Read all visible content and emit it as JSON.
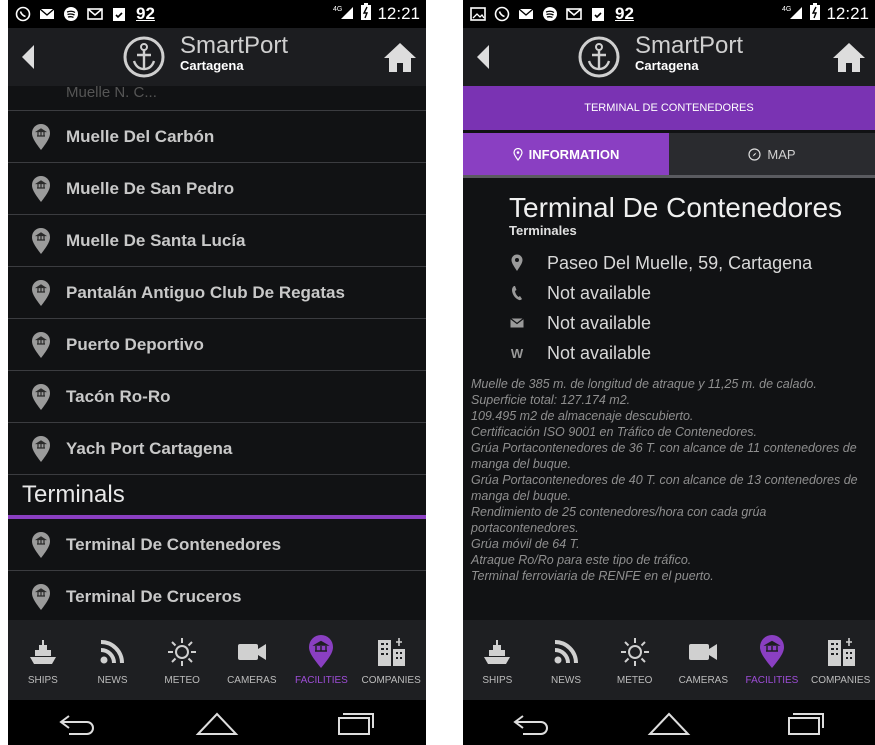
{
  "status": {
    "left_number": "92",
    "network": "4G",
    "time": "12:21"
  },
  "app": {
    "brand": "SmartPort",
    "city": "Cartagena"
  },
  "left_list": {
    "ghost": "Muelle N. C...",
    "items_a": [
      "Muelle Del Carbón",
      "Muelle De San Pedro",
      "Muelle De Santa Lucía",
      "Pantalán Antiguo Club De Regatas",
      "Puerto Deportivo",
      "Tacón Ro-Ro",
      "Yach Port Cartagena"
    ],
    "section": "Terminals",
    "items_b": [
      "Terminal De Contenedores",
      "Terminal De Cruceros"
    ]
  },
  "nav": [
    "SHIPS",
    "NEWS",
    "METEO",
    "CAMERAS",
    "FACILITIES",
    "COMPANIES"
  ],
  "nav_active": "FACILITIES",
  "detail": {
    "header": "TERMINAL DE CONTENEDORES",
    "tab_info": "INFORMATION",
    "tab_map": "MAP",
    "title": "Terminal De Contenedores",
    "subtitle": "Terminales",
    "address": "Paseo Del Muelle, 59, Cartagena",
    "phone": "Not available",
    "email": "Not available",
    "web": "Not available",
    "web_letter": "W",
    "description": [
      "Muelle de 385 m. de longitud de atraque y 11,25 m. de calado.",
      "Superficie total: 127.174 m2.",
      "109.495 m2 de almacenaje descubierto.",
      "Certificación ISO 9001 en Tráfico de Contenedores.",
      "Grúa Portacontenedores de 36 T. con alcance de 11 contenedores de manga del buque.",
      "Grúa Portacontenedores de 40 T. con alcance de 13 contenedores de manga del buque.",
      "Rendimiento de 25 contenedores/hora con cada grúa portacontenedores.",
      "Grúa móvil de 64 T.",
      "Atraque Ro/Ro para este tipo de tráfico.",
      "Terminal ferroviaria de RENFE en el puerto."
    ]
  },
  "colors": {
    "accent": "#8a3fc2",
    "header_purple": "#7a33b3",
    "background": "#111214"
  }
}
